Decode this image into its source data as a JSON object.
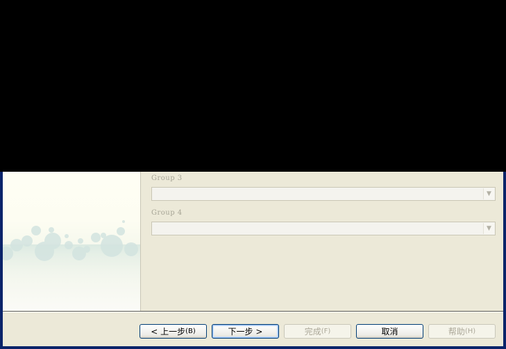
{
  "wizard": {
    "groups": [
      {
        "label": "Group 3",
        "value": ""
      },
      {
        "label": "Group 4",
        "value": ""
      }
    ],
    "buttons": {
      "back": {
        "prefix": "< ",
        "label": "上一步",
        "mnemonic": "(B)"
      },
      "next": {
        "label": "下一步",
        "suffix": " >"
      },
      "finish": {
        "label": "完成",
        "mnemonic": "(F)"
      },
      "cancel": {
        "label": "取消"
      },
      "help": {
        "label": "帮助",
        "mnemonic": "(H)"
      }
    }
  },
  "colors": {
    "frame": "#0a246a",
    "client": "#ece9d8",
    "disabled_text": "#aca899",
    "button_border": "#003c74"
  },
  "icons": {
    "combo_arrow": "chevron-down-icon",
    "side_art": "bubbles-decoration"
  }
}
